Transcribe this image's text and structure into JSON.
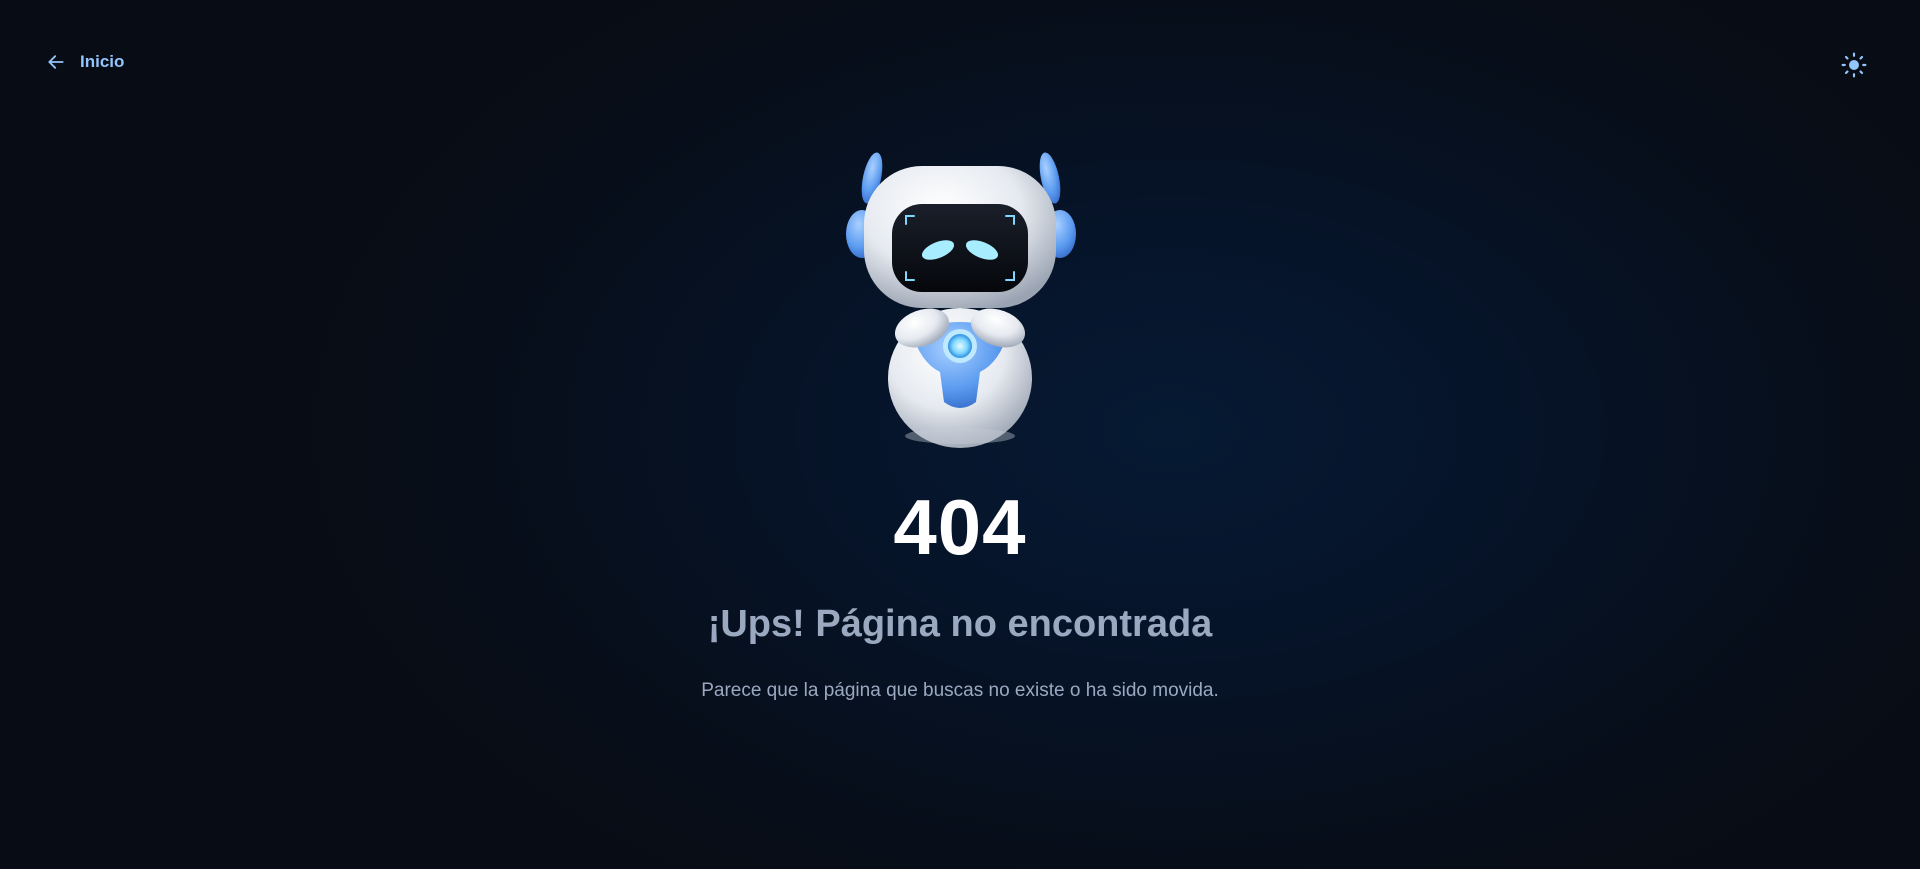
{
  "header": {
    "back_label": "Inicio",
    "back_icon": "arrow-left-icon",
    "theme_icon": "sun-icon"
  },
  "error": {
    "code": "404",
    "title": "¡Ups! Página no encontrada",
    "message": "Parece que la página que buscas no existe o ha sido movida."
  },
  "illustration": {
    "name": "robot-illustration"
  },
  "colors": {
    "accent": "#93c5fd",
    "muted_text": "#9aa8c0",
    "background": "#070f1c"
  }
}
